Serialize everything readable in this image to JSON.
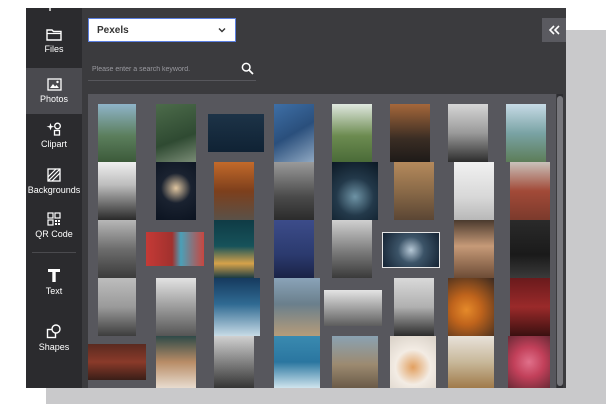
{
  "sidebar": {
    "items": [
      {
        "label": "Files",
        "icon": "folder-icon",
        "active": false
      },
      {
        "label": "Photos",
        "icon": "photo-icon",
        "active": true
      },
      {
        "label": "Clipart",
        "icon": "clipart-icon",
        "active": false
      },
      {
        "label": "Backgrounds",
        "icon": "backgrounds-icon",
        "active": false
      },
      {
        "label": "QR Code",
        "icon": "qr-code-icon",
        "active": false
      },
      {
        "label": "Text",
        "icon": "text-icon",
        "active": false
      },
      {
        "label": "Shapes",
        "icon": "shapes-icon",
        "active": false
      }
    ]
  },
  "source": {
    "selected": "Pexels"
  },
  "search": {
    "placeholder": "Please enter a search keyword."
  },
  "colors": {
    "active_tab": "#4a4a4f",
    "dropdown_border": "#5b7fe0",
    "panel": "#3b3b3e"
  }
}
